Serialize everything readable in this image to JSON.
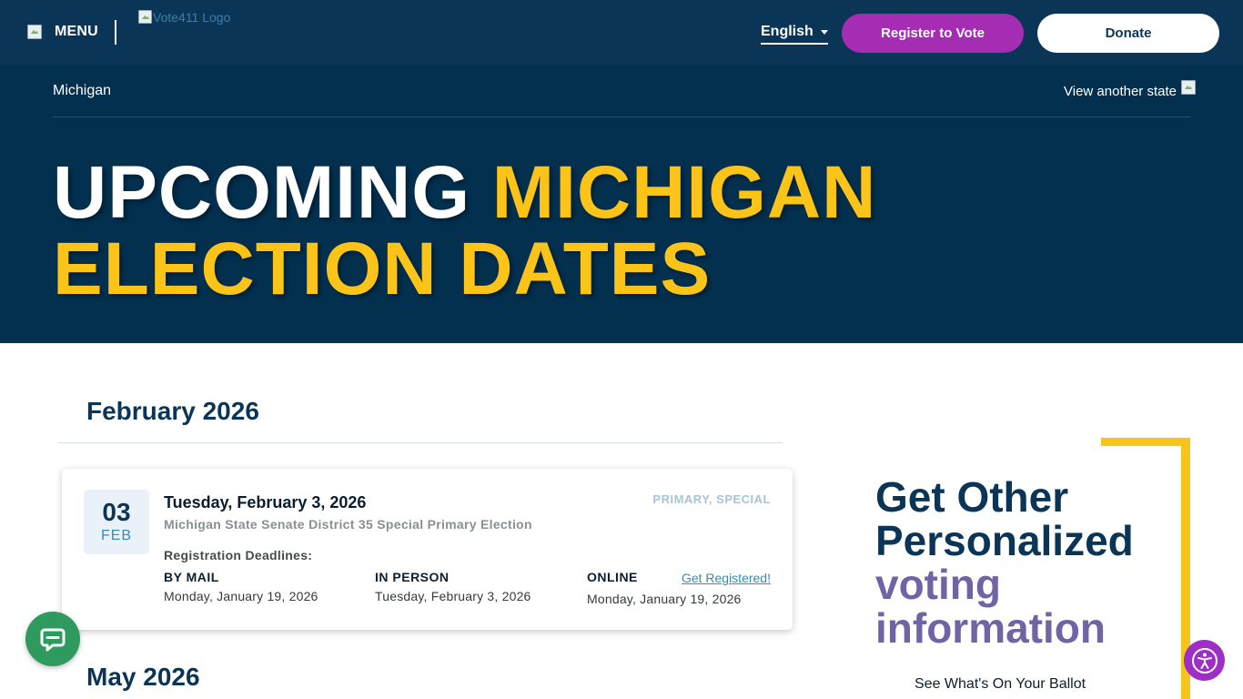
{
  "header": {
    "menu_label": "MENU",
    "logo_alt": "Vote411 Logo",
    "language": "English",
    "register_button": "Register to Vote",
    "donate_button": "Donate"
  },
  "hero": {
    "state": "Michigan",
    "view_another_state": "View another state",
    "title_white": "UPCOMING ",
    "title_yellow": "MICHIGAN ELECTION DATES"
  },
  "months": [
    {
      "label": "February 2026",
      "elections": [
        {
          "day": "03",
          "month_abbr": "FEB",
          "full_date": "Tuesday, February 3, 2026",
          "type": "PRIMARY, SPECIAL",
          "name": "Michigan State Senate District 35 Special Primary Election",
          "registration_label": "Registration Deadlines:",
          "deadlines": {
            "by_mail": {
              "label": "BY MAIL",
              "date": "Monday, January 19, 2026"
            },
            "in_person": {
              "label": "IN PERSON",
              "date": "Tuesday, February 3, 2026"
            },
            "online": {
              "label": "ONLINE",
              "date": "Monday, January 19, 2026",
              "link": "Get Registered!"
            }
          }
        }
      ]
    },
    {
      "label": "May 2026"
    }
  ],
  "promo": {
    "line1": "Get Other",
    "line2": "Personalized",
    "line3": "voting",
    "line4": "information",
    "link": "See What's On Your Ballot"
  },
  "colors": {
    "nav_bg": "#0b3557",
    "hero_bg": "#03304f",
    "accent_yellow": "#fcc419",
    "register_purple": "#a42db3",
    "link_teal": "#2b91b5",
    "promo_purple": "#7263a5",
    "chat_green": "#2f9a5e"
  },
  "icons": {
    "chat": "chat-bubble-icon",
    "accessibility": "accessibility-icon",
    "language_caret": "caret-down-icon"
  }
}
